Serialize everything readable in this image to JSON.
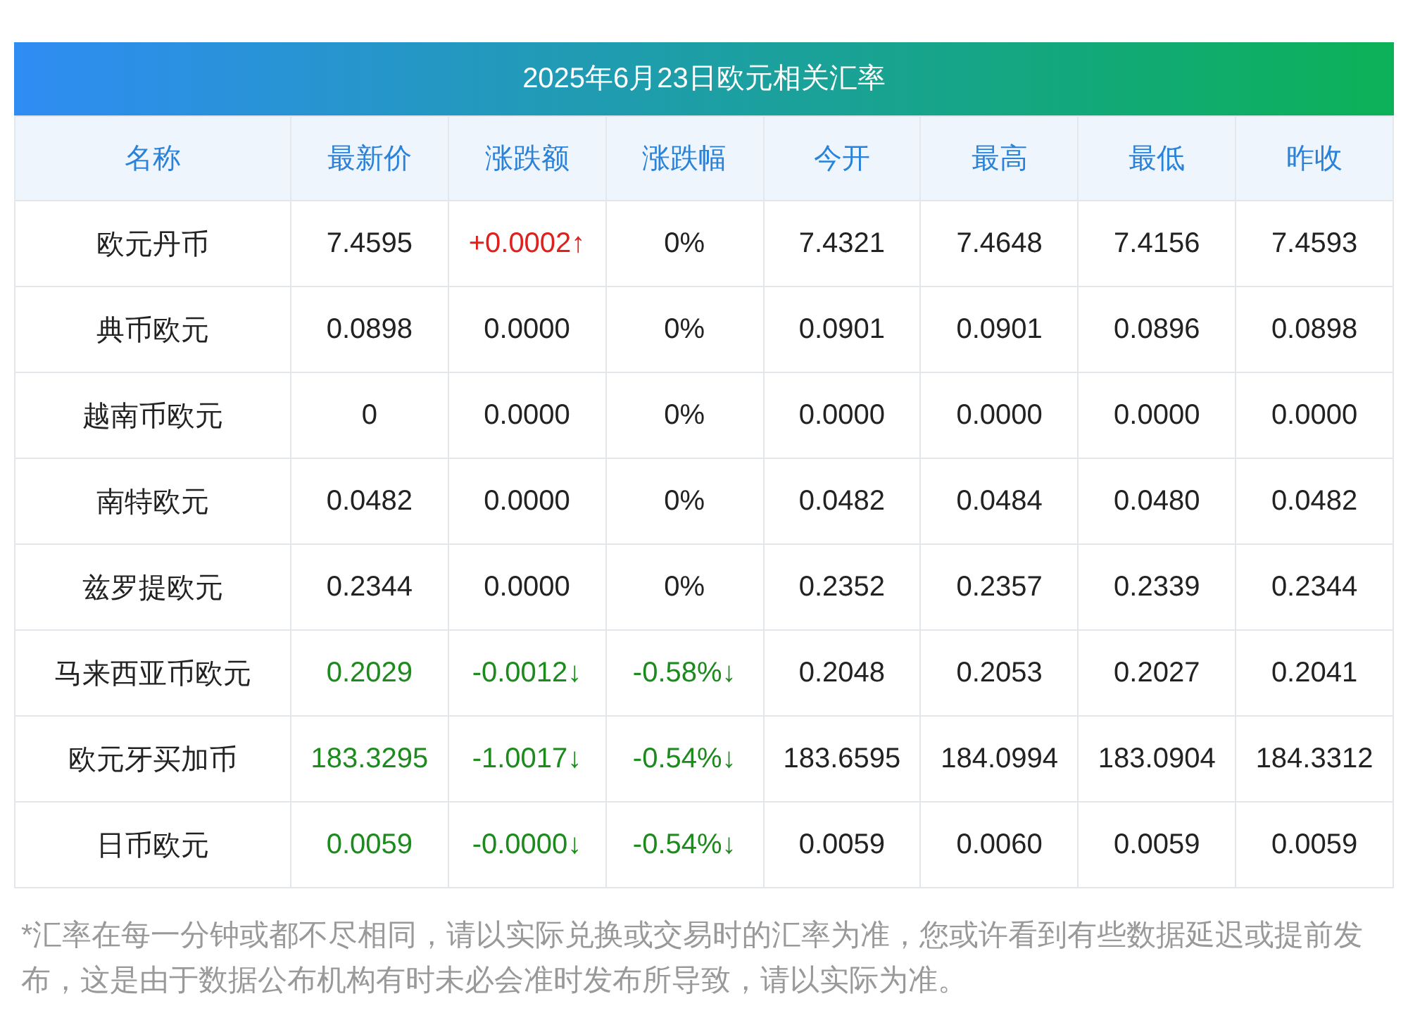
{
  "title": "2025年6月23日欧元相关汇率",
  "columns": [
    "名称",
    "最新价",
    "涨跌额",
    "涨跌幅",
    "今开",
    "最高",
    "最低",
    "昨收"
  ],
  "rows": [
    {
      "name": "欧元丹币",
      "cells": [
        {
          "text": "7.4595",
          "color": "#222222"
        },
        {
          "text": "+0.0002↑",
          "color": "#e0201c"
        },
        {
          "text": "0%",
          "color": "#222222"
        },
        {
          "text": "7.4321",
          "color": "#222222"
        },
        {
          "text": "7.4648",
          "color": "#222222"
        },
        {
          "text": "7.4156",
          "color": "#222222"
        },
        {
          "text": "7.4593",
          "color": "#222222"
        }
      ]
    },
    {
      "name": "典币欧元",
      "cells": [
        {
          "text": "0.0898",
          "color": "#222222"
        },
        {
          "text": "0.0000",
          "color": "#222222"
        },
        {
          "text": "0%",
          "color": "#222222"
        },
        {
          "text": "0.0901",
          "color": "#222222"
        },
        {
          "text": "0.0901",
          "color": "#222222"
        },
        {
          "text": "0.0896",
          "color": "#222222"
        },
        {
          "text": "0.0898",
          "color": "#222222"
        }
      ]
    },
    {
      "name": "越南币欧元",
      "cells": [
        {
          "text": "0",
          "color": "#222222"
        },
        {
          "text": "0.0000",
          "color": "#222222"
        },
        {
          "text": "0%",
          "color": "#222222"
        },
        {
          "text": "0.0000",
          "color": "#222222"
        },
        {
          "text": "0.0000",
          "color": "#222222"
        },
        {
          "text": "0.0000",
          "color": "#222222"
        },
        {
          "text": "0.0000",
          "color": "#222222"
        }
      ]
    },
    {
      "name": "南特欧元",
      "cells": [
        {
          "text": "0.0482",
          "color": "#222222"
        },
        {
          "text": "0.0000",
          "color": "#222222"
        },
        {
          "text": "0%",
          "color": "#222222"
        },
        {
          "text": "0.0482",
          "color": "#222222"
        },
        {
          "text": "0.0484",
          "color": "#222222"
        },
        {
          "text": "0.0480",
          "color": "#222222"
        },
        {
          "text": "0.0482",
          "color": "#222222"
        }
      ]
    },
    {
      "name": "兹罗提欧元",
      "cells": [
        {
          "text": "0.2344",
          "color": "#222222"
        },
        {
          "text": "0.0000",
          "color": "#222222"
        },
        {
          "text": "0%",
          "color": "#222222"
        },
        {
          "text": "0.2352",
          "color": "#222222"
        },
        {
          "text": "0.2357",
          "color": "#222222"
        },
        {
          "text": "0.2339",
          "color": "#222222"
        },
        {
          "text": "0.2344",
          "color": "#222222"
        }
      ]
    },
    {
      "name": "马来西亚币欧元",
      "cells": [
        {
          "text": "0.2029",
          "color": "#1d8a1d"
        },
        {
          "text": "-0.0012↓",
          "color": "#1d8a1d"
        },
        {
          "text": "-0.58%↓",
          "color": "#1d8a1d"
        },
        {
          "text": "0.2048",
          "color": "#222222"
        },
        {
          "text": "0.2053",
          "color": "#222222"
        },
        {
          "text": "0.2027",
          "color": "#222222"
        },
        {
          "text": "0.2041",
          "color": "#222222"
        }
      ]
    },
    {
      "name": "欧元牙买加币",
      "cells": [
        {
          "text": "183.3295",
          "color": "#1d8a1d"
        },
        {
          "text": "-1.0017↓",
          "color": "#1d8a1d"
        },
        {
          "text": "-0.54%↓",
          "color": "#1d8a1d"
        },
        {
          "text": "183.6595",
          "color": "#222222"
        },
        {
          "text": "184.0994",
          "color": "#222222"
        },
        {
          "text": "183.0904",
          "color": "#222222"
        },
        {
          "text": "184.3312",
          "color": "#222222"
        }
      ]
    },
    {
      "name": "日币欧元",
      "cells": [
        {
          "text": "0.0059",
          "color": "#1d8a1d"
        },
        {
          "text": "-0.0000↓",
          "color": "#1d8a1d"
        },
        {
          "text": "-0.54%↓",
          "color": "#1d8a1d"
        },
        {
          "text": "0.0059",
          "color": "#222222"
        },
        {
          "text": "0.0060",
          "color": "#222222"
        },
        {
          "text": "0.0059",
          "color": "#222222"
        },
        {
          "text": "0.0059",
          "color": "#222222"
        }
      ]
    }
  ],
  "footnote": "*汇率在每一分钟或都不尽相同，请以实际兑换或交易时的汇率为准，您或许看到有些数据延迟或提前发布，这是由于数据公布机构有时未必会准时发布所导致，请以实际为准。"
}
